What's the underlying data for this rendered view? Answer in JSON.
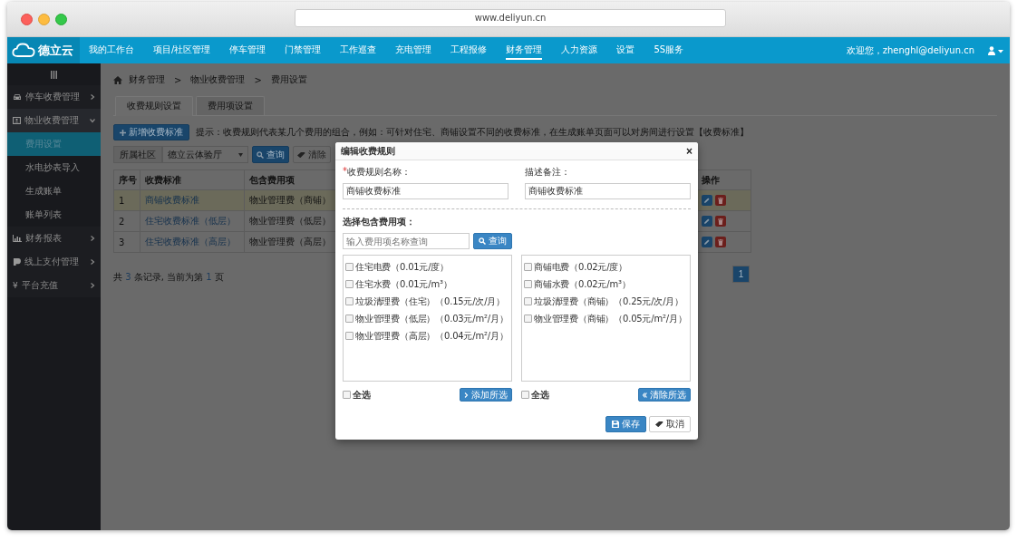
{
  "browser": {
    "url": "www.deliyun.cn"
  },
  "nav": {
    "logo": "德立云",
    "items": [
      {
        "label": "我的工作台",
        "selected": false
      },
      {
        "label": "项目/社区管理",
        "selected": false
      },
      {
        "label": "停车管理",
        "selected": false
      },
      {
        "label": "门禁管理",
        "selected": false
      },
      {
        "label": "工作巡查",
        "selected": false
      },
      {
        "label": "充电管理",
        "selected": false
      },
      {
        "label": "工程报修",
        "selected": false
      },
      {
        "label": "财务管理",
        "selected": true
      },
      {
        "label": "人力资源",
        "selected": false
      },
      {
        "label": "设置",
        "selected": false
      },
      {
        "label": "5S服务",
        "selected": false
      }
    ],
    "welcome": "欢迎您，zhenghl@deliyun.cn"
  },
  "sidebar": {
    "items": [
      {
        "label": "停车收费管理",
        "expanded": false
      },
      {
        "label": "物业收费管理",
        "expanded": true,
        "children": [
          {
            "label": "费用设置",
            "selected": true
          },
          {
            "label": "水电抄表导入",
            "selected": false
          },
          {
            "label": "生成账单",
            "selected": false
          },
          {
            "label": "账单列表",
            "selected": false
          }
        ]
      },
      {
        "label": "财务报表",
        "expanded": false
      },
      {
        "label": "线上支付管理",
        "expanded": false
      },
      {
        "label": "平台充值",
        "expanded": false,
        "symbol": "¥"
      }
    ]
  },
  "breadcrumb": [
    "财务管理",
    ">",
    "物业收费管理",
    ">",
    "费用设置"
  ],
  "tabs": [
    {
      "label": "收费规则设置",
      "selected": true
    },
    {
      "label": "费用项设置",
      "selected": false
    }
  ],
  "add_button": "新增收费标准",
  "hint": "提示：收费规则代表某几个费用的组合，例如：可针对住宅、商铺设置不同的收费标准，在生成账单页面可以对房间进行设置【收费标准】",
  "filter": {
    "label": "所属社区",
    "select_value": "德立云体验厅",
    "search_button": "查询",
    "clear_button": "清除"
  },
  "table": {
    "columns": [
      "序号",
      "收费标准",
      "包含费用项",
      "操作"
    ],
    "rows": [
      {
        "selected": true,
        "cells": [
          "1",
          "商铺收费标准",
          "物业管理费（商铺）"
        ]
      },
      {
        "selected": false,
        "cells": [
          "2",
          "住宅收费标准（低层）",
          "物业管理费（低层）"
        ]
      },
      {
        "selected": false,
        "cells": [
          "3",
          "住宅收费标准（高层）",
          "物业管理费（高层）"
        ]
      }
    ]
  },
  "footer": {
    "before": "共",
    "count": "3",
    "middle": "条记录, 当前为第",
    "page": "1",
    "after": "页"
  },
  "pagination": [
    {
      "label": "1",
      "selected": true
    }
  ],
  "modal": {
    "title": "编辑收费规则",
    "close": "×",
    "required_mark": "*",
    "name_label": "收费规则名称：",
    "name_value": "商铺收费标准",
    "remark_label": "描述备注：",
    "remark_value": "商铺收费标准",
    "section_title": "选择包含费用项：",
    "search_placeholder": "输入费用项名称查询",
    "search_button": "查询",
    "left_list": [
      {
        "label": "住宅电费（0.01元/度）",
        "checked": false
      },
      {
        "label": "住宅水费（0.01元/m³）",
        "checked": false
      },
      {
        "label": "垃圾清理费（住宅）（0.15元/次/月）",
        "checked": false
      },
      {
        "label": "物业管理费（低层）（0.03元/m²/月）",
        "checked": false
      },
      {
        "label": "物业管理费（高层）（0.04元/m²/月）",
        "checked": false
      }
    ],
    "right_list": [
      {
        "label": "商铺电费（0.02元/度）",
        "checked": false
      },
      {
        "label": "商铺水费（0.02元/m³）",
        "checked": false
      },
      {
        "label": "垃圾清理费（商铺）（0.25元/次/月）",
        "checked": false
      },
      {
        "label": "物业管理费（商铺）（0.05元/m²/月）",
        "checked": false
      }
    ],
    "left_select_all": {
      "label": "全选",
      "checked": false
    },
    "right_select_all": {
      "label": "全选",
      "checked": false
    },
    "add_selected": "添加所选",
    "remove_selected": "清除所选",
    "save": "保存",
    "cancel": "取消"
  }
}
